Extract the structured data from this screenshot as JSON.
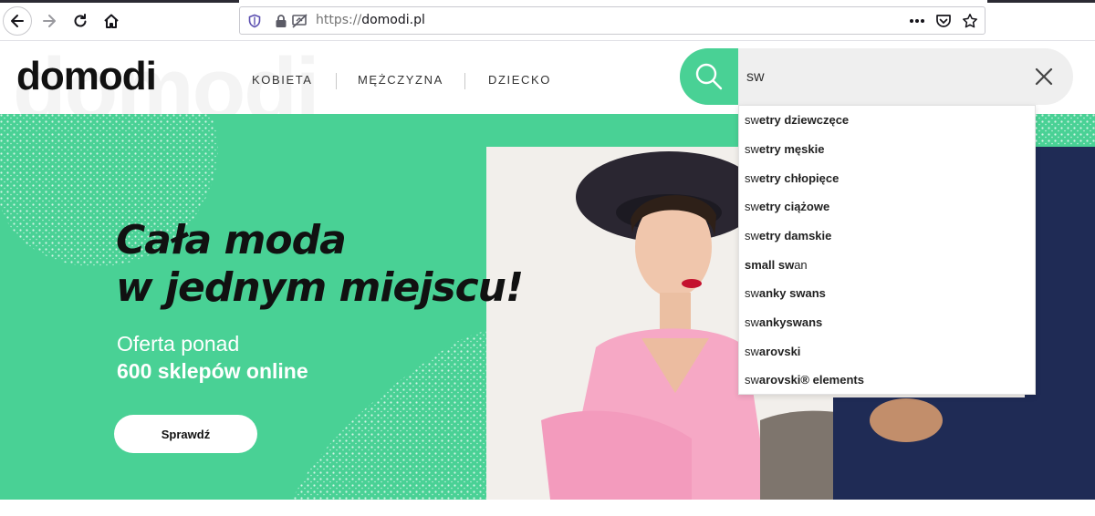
{
  "browser": {
    "url_protocol": "https://",
    "url_domain": "domodi.pl"
  },
  "site": {
    "logo": "domodi",
    "bg_wordmark": "domodi",
    "nav": [
      "KOBIETA",
      "MĘŻCZYZNA",
      "DZIECKO"
    ]
  },
  "search": {
    "value": "sw",
    "suggestions": [
      {
        "prefix": "sw",
        "rest": "etry dziewczęce"
      },
      {
        "prefix": "sw",
        "rest": "etry męskie"
      },
      {
        "prefix": "sw",
        "rest": "etry chłopięce"
      },
      {
        "prefix": "sw",
        "rest": "etry ciążowe"
      },
      {
        "prefix": "sw",
        "rest": "etry damskie"
      },
      {
        "prefix": "small sw",
        "rest": "an"
      },
      {
        "prefix": "sw",
        "rest": "anky swans"
      },
      {
        "prefix": "sw",
        "rest": "ankyswans"
      },
      {
        "prefix": "sw",
        "rest": "arovski"
      },
      {
        "prefix": "sw",
        "rest": "arovski® elements"
      }
    ]
  },
  "hero": {
    "headline_line1": "Cała moda",
    "headline_line2": "w jednym miejscu!",
    "sub_line1": "Oferta ponad",
    "sub_line2": "600 sklepów online",
    "cta": "Sprawdź"
  },
  "colors": {
    "brand_green": "#49d195",
    "text_dark": "#111111"
  },
  "icons": [
    "back-arrow-icon",
    "forward-arrow-icon",
    "reload-icon",
    "home-icon",
    "shield-icon",
    "lock-icon",
    "permissions-icon",
    "more-icon",
    "pocket-icon",
    "star-icon",
    "search-icon",
    "close-icon"
  ]
}
